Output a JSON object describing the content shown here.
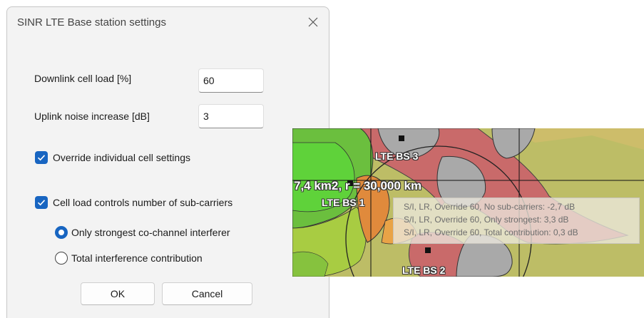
{
  "dialog": {
    "title": "SINR LTE Base station settings",
    "downlink_label": "Downlink cell load [%]",
    "downlink_value": "60",
    "uplink_label": "Uplink noise increase [dB]",
    "uplink_value": "3",
    "override_label": "Override individual cell settings",
    "override_checked": true,
    "cellload_label": "Cell load controls number of sub-carriers",
    "cellload_checked": true,
    "radio_strongest_label": "Only strongest co-channel interferer",
    "radio_strongest_selected": true,
    "radio_total_label": "Total interference contribution",
    "ok_label": "OK",
    "cancel_label": "Cancel"
  },
  "map": {
    "bs1_label": "LTE BS 1",
    "bs2_label": "LTE BS 2",
    "bs3_label": "LTE BS 3",
    "measure_label": "7,4 km2, r = 30,000 km",
    "tooltip_lines": [
      "S/I, LR, Override 60, No sub-carriers: -2,7 dB",
      "S/I, LR, Override 60, Only strongest: 3,3 dB",
      "S/I, LR, Override 60, Total contribution: 0,3 dB"
    ]
  },
  "colors": {
    "accent": "#1865c1",
    "green": "#6bbf3e",
    "red": "#c96a6a",
    "gray": "#a9a9a9",
    "olive": "#bdbd66"
  }
}
